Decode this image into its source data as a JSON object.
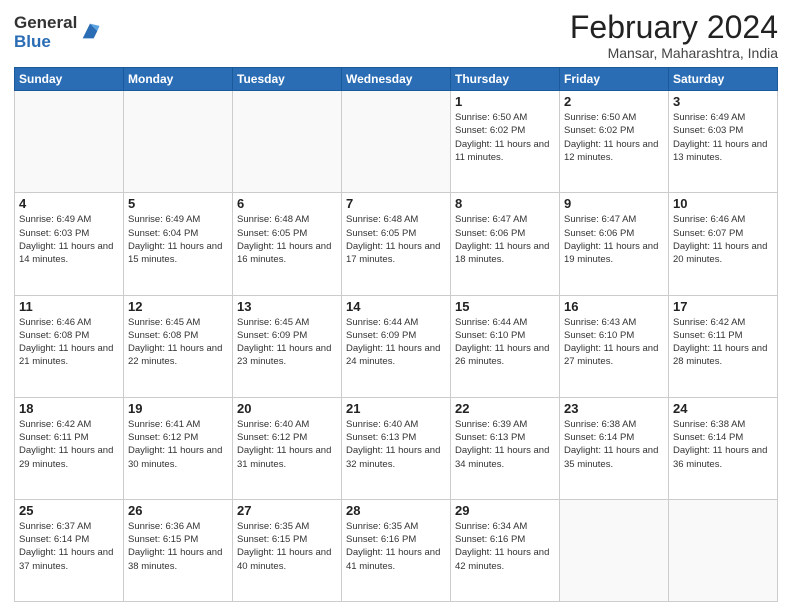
{
  "logo": {
    "general": "General",
    "blue": "Blue"
  },
  "header": {
    "month_year": "February 2024",
    "location": "Mansar, Maharashtra, India"
  },
  "days_of_week": [
    "Sunday",
    "Monday",
    "Tuesday",
    "Wednesday",
    "Thursday",
    "Friday",
    "Saturday"
  ],
  "weeks": [
    [
      {
        "day": "",
        "info": ""
      },
      {
        "day": "",
        "info": ""
      },
      {
        "day": "",
        "info": ""
      },
      {
        "day": "",
        "info": ""
      },
      {
        "day": "1",
        "info": "Sunrise: 6:50 AM\nSunset: 6:02 PM\nDaylight: 11 hours\nand 11 minutes."
      },
      {
        "day": "2",
        "info": "Sunrise: 6:50 AM\nSunset: 6:02 PM\nDaylight: 11 hours\nand 12 minutes."
      },
      {
        "day": "3",
        "info": "Sunrise: 6:49 AM\nSunset: 6:03 PM\nDaylight: 11 hours\nand 13 minutes."
      }
    ],
    [
      {
        "day": "4",
        "info": "Sunrise: 6:49 AM\nSunset: 6:03 PM\nDaylight: 11 hours\nand 14 minutes."
      },
      {
        "day": "5",
        "info": "Sunrise: 6:49 AM\nSunset: 6:04 PM\nDaylight: 11 hours\nand 15 minutes."
      },
      {
        "day": "6",
        "info": "Sunrise: 6:48 AM\nSunset: 6:05 PM\nDaylight: 11 hours\nand 16 minutes."
      },
      {
        "day": "7",
        "info": "Sunrise: 6:48 AM\nSunset: 6:05 PM\nDaylight: 11 hours\nand 17 minutes."
      },
      {
        "day": "8",
        "info": "Sunrise: 6:47 AM\nSunset: 6:06 PM\nDaylight: 11 hours\nand 18 minutes."
      },
      {
        "day": "9",
        "info": "Sunrise: 6:47 AM\nSunset: 6:06 PM\nDaylight: 11 hours\nand 19 minutes."
      },
      {
        "day": "10",
        "info": "Sunrise: 6:46 AM\nSunset: 6:07 PM\nDaylight: 11 hours\nand 20 minutes."
      }
    ],
    [
      {
        "day": "11",
        "info": "Sunrise: 6:46 AM\nSunset: 6:08 PM\nDaylight: 11 hours\nand 21 minutes."
      },
      {
        "day": "12",
        "info": "Sunrise: 6:45 AM\nSunset: 6:08 PM\nDaylight: 11 hours\nand 22 minutes."
      },
      {
        "day": "13",
        "info": "Sunrise: 6:45 AM\nSunset: 6:09 PM\nDaylight: 11 hours\nand 23 minutes."
      },
      {
        "day": "14",
        "info": "Sunrise: 6:44 AM\nSunset: 6:09 PM\nDaylight: 11 hours\nand 24 minutes."
      },
      {
        "day": "15",
        "info": "Sunrise: 6:44 AM\nSunset: 6:10 PM\nDaylight: 11 hours\nand 26 minutes."
      },
      {
        "day": "16",
        "info": "Sunrise: 6:43 AM\nSunset: 6:10 PM\nDaylight: 11 hours\nand 27 minutes."
      },
      {
        "day": "17",
        "info": "Sunrise: 6:42 AM\nSunset: 6:11 PM\nDaylight: 11 hours\nand 28 minutes."
      }
    ],
    [
      {
        "day": "18",
        "info": "Sunrise: 6:42 AM\nSunset: 6:11 PM\nDaylight: 11 hours\nand 29 minutes."
      },
      {
        "day": "19",
        "info": "Sunrise: 6:41 AM\nSunset: 6:12 PM\nDaylight: 11 hours\nand 30 minutes."
      },
      {
        "day": "20",
        "info": "Sunrise: 6:40 AM\nSunset: 6:12 PM\nDaylight: 11 hours\nand 31 minutes."
      },
      {
        "day": "21",
        "info": "Sunrise: 6:40 AM\nSunset: 6:13 PM\nDaylight: 11 hours\nand 32 minutes."
      },
      {
        "day": "22",
        "info": "Sunrise: 6:39 AM\nSunset: 6:13 PM\nDaylight: 11 hours\nand 34 minutes."
      },
      {
        "day": "23",
        "info": "Sunrise: 6:38 AM\nSunset: 6:14 PM\nDaylight: 11 hours\nand 35 minutes."
      },
      {
        "day": "24",
        "info": "Sunrise: 6:38 AM\nSunset: 6:14 PM\nDaylight: 11 hours\nand 36 minutes."
      }
    ],
    [
      {
        "day": "25",
        "info": "Sunrise: 6:37 AM\nSunset: 6:14 PM\nDaylight: 11 hours\nand 37 minutes."
      },
      {
        "day": "26",
        "info": "Sunrise: 6:36 AM\nSunset: 6:15 PM\nDaylight: 11 hours\nand 38 minutes."
      },
      {
        "day": "27",
        "info": "Sunrise: 6:35 AM\nSunset: 6:15 PM\nDaylight: 11 hours\nand 40 minutes."
      },
      {
        "day": "28",
        "info": "Sunrise: 6:35 AM\nSunset: 6:16 PM\nDaylight: 11 hours\nand 41 minutes."
      },
      {
        "day": "29",
        "info": "Sunrise: 6:34 AM\nSunset: 6:16 PM\nDaylight: 11 hours\nand 42 minutes."
      },
      {
        "day": "",
        "info": ""
      },
      {
        "day": "",
        "info": ""
      }
    ]
  ]
}
